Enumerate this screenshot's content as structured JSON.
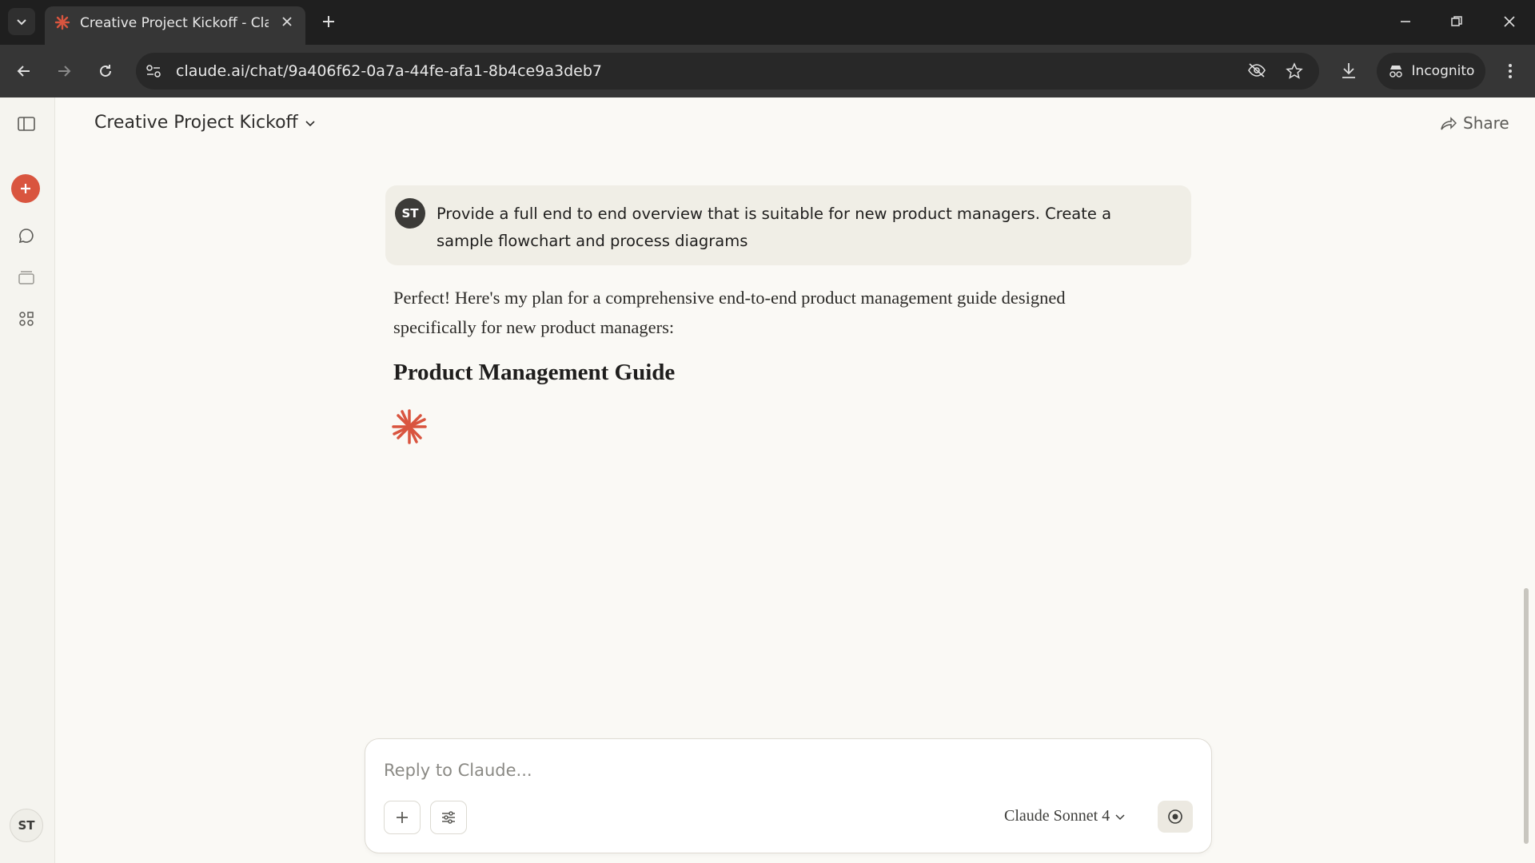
{
  "browser": {
    "tab_title": "Creative Project Kickoff - Claude",
    "url": "claude.ai/chat/9a406f62-0a7a-44fe-afa1-8b4ce9a3deb7",
    "incognito_label": "Incognito"
  },
  "header": {
    "conversation_title": "Creative Project Kickoff",
    "share_label": "Share"
  },
  "sidebar": {
    "user_initials": "ST"
  },
  "messages": {
    "user": {
      "initials": "ST",
      "text": "Provide a full end to end overview that is suitable for new product managers. Create a sample flowchart and process diagrams"
    },
    "assistant": {
      "text": "Perfect! Here's my plan for a comprehensive end-to-end product management guide designed specifically for new product managers:",
      "heading": "Product Management Guide"
    }
  },
  "composer": {
    "placeholder": "Reply to Claude...",
    "model_label": "Claude Sonnet 4"
  },
  "colors": {
    "accent": "#d9553f",
    "background": "#faf9f5"
  }
}
